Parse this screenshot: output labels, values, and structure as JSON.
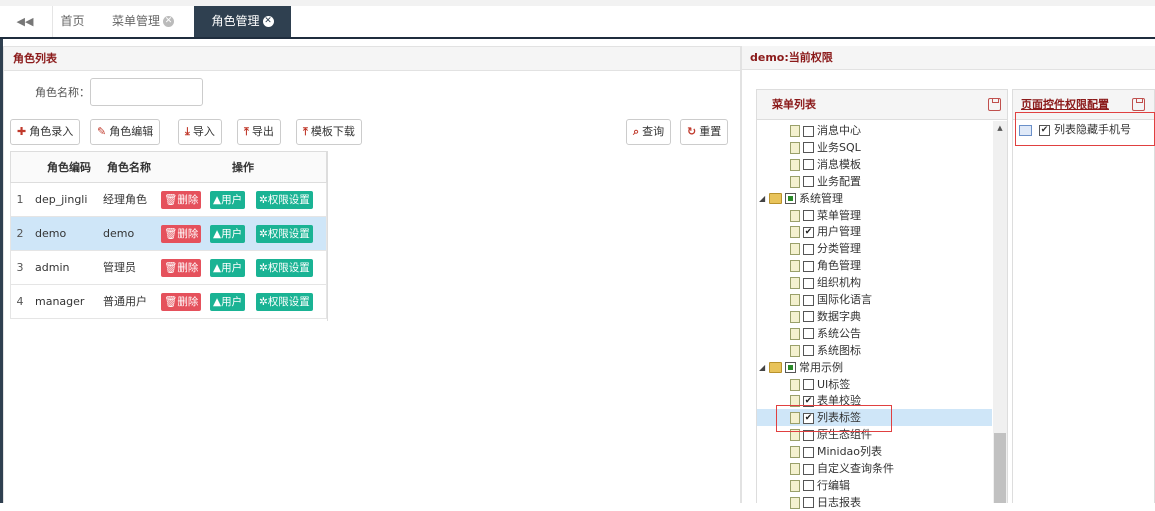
{
  "tabs": {
    "prev_arrow": "◀◀",
    "home": "首页",
    "menu_mgmt": "菜单管理",
    "role_mgmt": "角色管理",
    "close_glyph": "✕"
  },
  "left_panel": {
    "title": "角色列表",
    "search_label": "角色名称：",
    "search_value": "",
    "buttons": {
      "add": "角色录入",
      "edit": "角色编辑",
      "import": "导入",
      "export": "导出",
      "template": "模板下载",
      "query": "查询",
      "reset": "重置"
    },
    "columns": {
      "code": "角色编码",
      "name": "角色名称",
      "ops": "操作"
    },
    "action_labels": {
      "delete": "删除",
      "user": "用户",
      "perm": "权限设置"
    },
    "rows": [
      {
        "num": "1",
        "code": "dep_jingli",
        "name": "经理角色"
      },
      {
        "num": "2",
        "code": "demo",
        "name": "demo"
      },
      {
        "num": "3",
        "code": "admin",
        "name": "管理员"
      },
      {
        "num": "4",
        "code": "manager",
        "name": "普通用户"
      }
    ]
  },
  "right_panel": {
    "title": "demo:当前权限",
    "menu_list_title": "菜单列表",
    "page_ctrl_title": "页面控件权限配置",
    "tree": [
      {
        "label": "消息中心",
        "checked": false
      },
      {
        "label": "业务SQL",
        "checked": false
      },
      {
        "label": "消息模板",
        "checked": false
      },
      {
        "label": "业务配置",
        "checked": false
      },
      {
        "label": "系统管理",
        "checked": "partial",
        "folder": true
      },
      {
        "label": "菜单管理",
        "checked": false
      },
      {
        "label": "用户管理",
        "checked": true
      },
      {
        "label": "分类管理",
        "checked": false
      },
      {
        "label": "角色管理",
        "checked": false
      },
      {
        "label": "组织机构",
        "checked": false
      },
      {
        "label": "国际化语言",
        "checked": false
      },
      {
        "label": "数据字典",
        "checked": false
      },
      {
        "label": "系统公告",
        "checked": false
      },
      {
        "label": "系统图标",
        "checked": false
      },
      {
        "label": "常用示例",
        "checked": "partial",
        "folder": true
      },
      {
        "label": "UI标签",
        "checked": false
      },
      {
        "label": "表单校验",
        "checked": true
      },
      {
        "label": "列表标签",
        "checked": true,
        "selected": true
      },
      {
        "label": "原生态组件",
        "checked": false
      },
      {
        "label": "Minidao列表",
        "checked": false
      },
      {
        "label": "自定义查询条件",
        "checked": false
      },
      {
        "label": "行编辑",
        "checked": false
      },
      {
        "label": "日志报表",
        "checked": false
      }
    ],
    "page_ctrl_items": [
      {
        "label": "列表隐藏手机号",
        "checked": true
      }
    ]
  }
}
